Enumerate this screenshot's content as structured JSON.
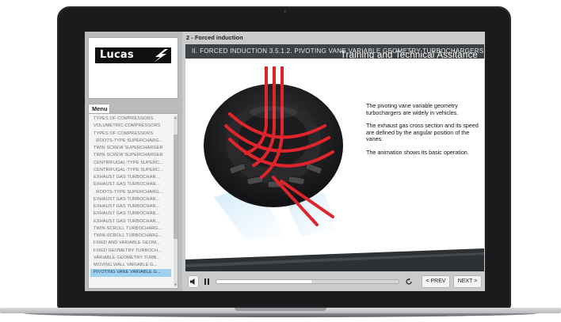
{
  "breadcrumb": "2 - Forced induction",
  "heading": "II. FORCED INDUCTION  3.5.1.2. PIVOTING VANE VARIABLE GEOMETRY TURBOCHARGERS",
  "logo_text": "Lucas",
  "menu": {
    "tab_label": "Menu",
    "items": [
      "TYPES OF COMPRESSORS",
      "VOLUMETRIC COMPRESSORS",
      "TYPES OF COMPRESSORS",
      ". ROOTS-TYPE SUPERCHARG...",
      "TWIN SCREW SUPERCHARGER",
      "TWIN SCREW SUPERCHARGER",
      "CENTRIFUGAL-TYPE SUPERC...",
      "CENTRIFUGAL-TYPE SUPERC...",
      "EXHAUST GAS TURBOCHAR...",
      "EXHAUST GAS TURBOCHAR...",
      ". ROOTS-TYPE SUPERCHARG...",
      "EXHAUST GAS TURBOCHAR...",
      "EXHAUST GAS TURBOCHAR...",
      "EXHAUST GAS TURBOCHAR...",
      "EXHAUST GAS TURBOCHAR...",
      "TWIN-SCROLL TURBOCHARG...",
      "TWIN-SCROLL TURBOCHARG...",
      "FIXED AND VARIABLE GEOM...",
      "FIXED GEOMETRY TURBOCH...",
      "VARIABLE GEOMETRY TURB...",
      "MOVING WALL VARIABLE G...",
      "PIVOTING VANE VARIABLE G..."
    ],
    "active_index": 21
  },
  "description": [
    "The pivoting vane variable geometry turbochargers are widely in vehicles.",
    "The exhaust gas cross section and its speed are defined by the angular position of the vanes.",
    "The animation shows its basic operation."
  ],
  "footer_text": "Training and Technical Assitance",
  "controls": {
    "prev_label": "< PREV",
    "next_label": "NEXT >",
    "progress": 0.52
  },
  "colors": {
    "heading_bg": "#3f4245",
    "active_item": "#9fd0ee",
    "footer_dark": "#2e3134",
    "accent_red": "#e0242c"
  },
  "icons": {
    "volume": "volume-icon",
    "pause": "pause-icon",
    "replay": "replay-icon"
  }
}
